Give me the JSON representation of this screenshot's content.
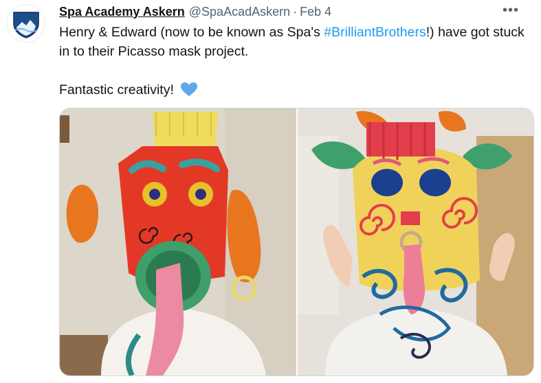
{
  "tweet": {
    "display_name": "Spa Academy Askern",
    "handle": "@SpaAcadAskern",
    "separator": "·",
    "date": "Feb 4",
    "more_icon": "more-horizontal-icon",
    "text_part1": "Henry & Edward (now to be known as Spa's ",
    "hashtag": "#BrilliantBrothers",
    "text_part2": "!) have got stuck in to their Picasso mask project.",
    "text_line2": "Fantastic creativity!",
    "emoji_icon": "blue-heart-icon",
    "avatar_icon": "school-crest-icon",
    "avatar_text": "Spa Academy Askern",
    "colors": {
      "hashtag": "#1d9bf0",
      "heart": "#5da9e9",
      "crest": "#1b4f8a"
    }
  },
  "media": {
    "photos": [
      {
        "name": "red-mask-photo"
      },
      {
        "name": "yellow-mask-photo"
      }
    ]
  }
}
